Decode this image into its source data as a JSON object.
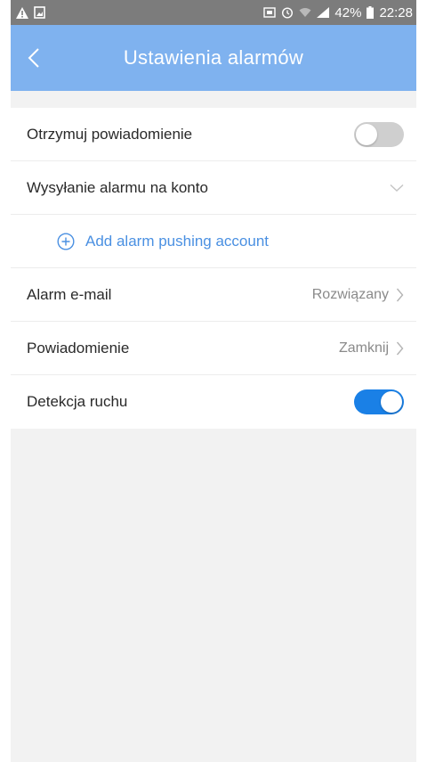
{
  "status_bar": {
    "battery": "42%",
    "time": "22:28"
  },
  "header": {
    "title": "Ustawienia alarmów"
  },
  "settings": {
    "receive_notification": {
      "label": "Otrzymuj powiadomienie",
      "enabled": false
    },
    "send_alarm_to_account": {
      "label": "Wysyłanie alarmu na konto"
    },
    "add_account": {
      "label": "Add alarm pushing account"
    },
    "alarm_email": {
      "label": "Alarm e-mail",
      "value": "Rozwiązany"
    },
    "notification": {
      "label": "Powiadomienie",
      "value": "Zamknij"
    },
    "motion_detection": {
      "label": "Detekcja ruchu",
      "enabled": true
    }
  },
  "colors": {
    "accent": "#1a80e6",
    "header_bg": "#7fb2ef",
    "link": "#4a90e2"
  },
  "icons": [
    "warning-icon",
    "image-icon",
    "sim-icon",
    "alarm-clock-icon",
    "wifi-icon",
    "signal-icon",
    "battery-icon",
    "back-arrow-icon",
    "chevron-down-icon",
    "add-circle-icon",
    "chevron-right-icon"
  ]
}
